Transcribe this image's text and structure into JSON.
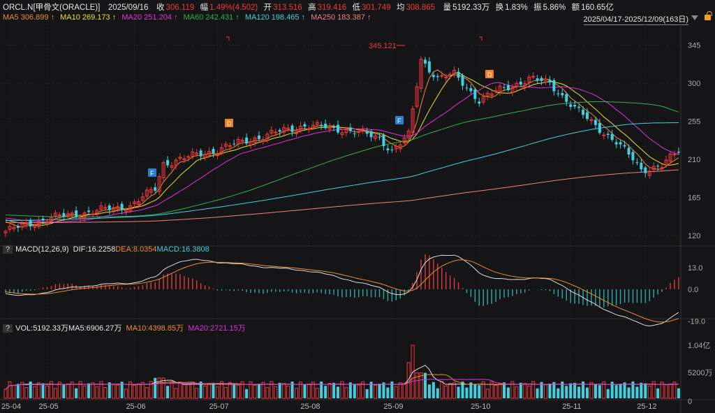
{
  "header": {
    "symbol": "ORCL.N[甲骨文(ORACLE)]",
    "date": "2025/09/16",
    "close_label": "收",
    "close": "306.119",
    "chg_label": "幅",
    "chg": "1.49%(4.502)",
    "open_label": "开",
    "open": "313.516",
    "high_label": "高",
    "high": "319.416",
    "low_label": "低",
    "low": "301.749",
    "avg_label": "均",
    "avg": "308.865",
    "vol_label": "量",
    "vol": "5192.33万",
    "turn_label": "换",
    "turn": "1.83%",
    "amp_label": "振",
    "amp": "5.86%",
    "amt_label": "额",
    "amt": "160.65亿"
  },
  "ma": [
    {
      "text": "MA5 306.899 ↑",
      "color": "#f08c30"
    },
    {
      "text": "MA10 269.173 ↑",
      "color": "#f0e020"
    },
    {
      "text": "MA20 251.204 ↑",
      "color": "#e030e0"
    },
    {
      "text": "MA60 242.431 ↑",
      "color": "#30b050"
    },
    {
      "text": "MA120 198.465 ↑",
      "color": "#40d0e0"
    },
    {
      "text": "MA250 183.387 ↑",
      "color": "#f08080"
    }
  ],
  "range": "2025/04/17-2025/12/09(163日)",
  "macd": {
    "q": "?",
    "title": "MACD(12,26,9)",
    "dif": "DIF:16.2258",
    "dea": "DEA:8.0354",
    "macd": "MACD:16.3808",
    "ticks": [
      "13.0",
      "0.0",
      "-19.0"
    ]
  },
  "vol": {
    "q": "?",
    "label": "VOL:5192.33万",
    "ma5": "MA5:6906.27万",
    "ma10": "MA10:4398.85万",
    "ma20": "MA20:2721.15万",
    "ticks": [
      "1.04亿",
      "5200万",
      "0"
    ]
  },
  "markers": {
    "high_label": "345.121",
    "f": "F",
    "d": "D"
  },
  "chart_data": {
    "type": "candlestick",
    "days": 163,
    "price_ticks": [
      345,
      300,
      255,
      210,
      165,
      120
    ],
    "close_keypoints": [
      [
        0,
        125
      ],
      [
        10,
        140
      ],
      [
        30,
        155
      ],
      [
        36,
        175
      ],
      [
        38,
        205
      ],
      [
        50,
        220
      ],
      [
        60,
        235
      ],
      [
        72,
        250
      ],
      [
        82,
        245
      ],
      [
        90,
        235
      ],
      [
        93,
        220
      ],
      [
        97,
        238
      ],
      [
        100,
        328
      ],
      [
        104,
        306
      ],
      [
        108,
        310
      ],
      [
        114,
        280
      ],
      [
        118,
        290
      ],
      [
        126,
        305
      ],
      [
        131,
        300
      ],
      [
        137,
        270
      ],
      [
        142,
        250
      ],
      [
        147,
        230
      ],
      [
        151,
        210
      ],
      [
        153,
        198
      ],
      [
        158,
        202
      ],
      [
        162,
        220
      ]
    ],
    "date_ticks": [
      [
        "25-04",
        1
      ],
      [
        "25-05",
        10
      ],
      [
        "25-06",
        31
      ],
      [
        "25-07",
        51
      ],
      [
        "25-08",
        73
      ],
      [
        "25-09",
        93
      ],
      [
        "25-10",
        114
      ],
      [
        "25-11",
        136
      ],
      [
        "25-12",
        154
      ]
    ]
  }
}
